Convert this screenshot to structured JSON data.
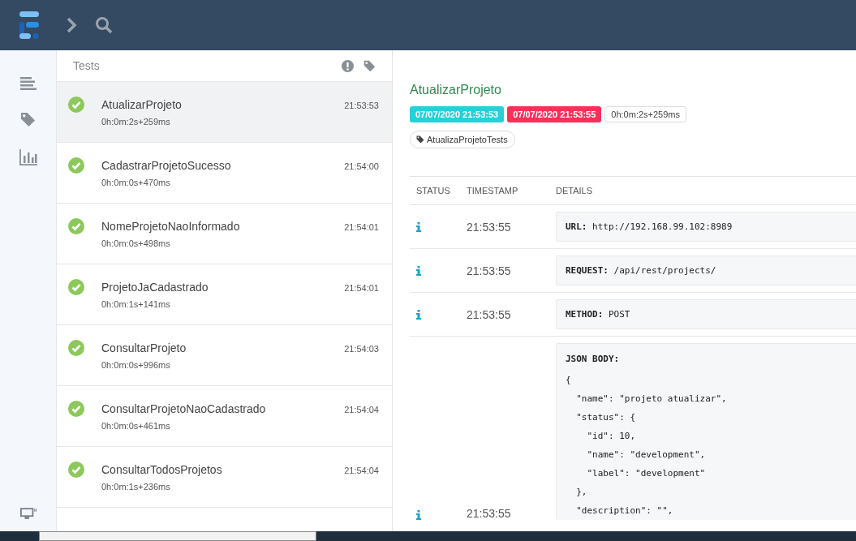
{
  "tests_panel": {
    "title": "Tests"
  },
  "tests": [
    {
      "name": "AtualizarProjeto",
      "time": "21:53:53",
      "duration": "0h:0m:2s+259ms",
      "selected": true
    },
    {
      "name": "CadastrarProjetoSucesso",
      "time": "21:54:00",
      "duration": "0h:0m:0s+470ms",
      "selected": false
    },
    {
      "name": "NomeProjetoNaoInformado",
      "time": "21:54:01",
      "duration": "0h:0m:0s+498ms",
      "selected": false
    },
    {
      "name": "ProjetoJaCadastrado",
      "time": "21:54:01",
      "duration": "0h:0m:1s+141ms",
      "selected": false
    },
    {
      "name": "ConsultarProjeto",
      "time": "21:54:03",
      "duration": "0h:0m:0s+996ms",
      "selected": false
    },
    {
      "name": "ConsultarProjetoNaoCadastrado",
      "time": "21:54:04",
      "duration": "0h:0m:0s+461ms",
      "selected": false
    },
    {
      "name": "ConsultarTodosProjetos",
      "time": "21:54:04",
      "duration": "0h:0m:1s+236ms",
      "selected": false
    }
  ],
  "detail": {
    "title": "AtualizarProjeto",
    "start": "07/07/2020 21:53:53",
    "end": "07/07/2020 21:53:55",
    "duration": "0h:0m:2s+259ms",
    "tag": "AtualizaProjetoTests",
    "columns": [
      "STATUS",
      "TIMESTAMP",
      "DETAILS"
    ],
    "logs": [
      {
        "kind": "line",
        "timestamp": "21:53:55",
        "label": "URL:",
        "value": "http://192.168.99.102:8989"
      },
      {
        "kind": "line",
        "timestamp": "21:53:55",
        "label": "REQUEST:",
        "value": "/api/rest/projects/"
      },
      {
        "kind": "line",
        "timestamp": "21:53:55",
        "label": "METHOD:",
        "value": "POST"
      },
      {
        "kind": "json",
        "timestamp": "21:53:55",
        "label": "JSON BODY:",
        "lines": [
          "{",
          "  \"name\": \"projeto atualizar\",",
          "  \"status\": {",
          "    \"id\": 10,",
          "    \"name\": \"development\",",
          "    \"label\": \"development\"",
          "  },",
          "  \"description\": \"\","
        ]
      }
    ]
  }
}
